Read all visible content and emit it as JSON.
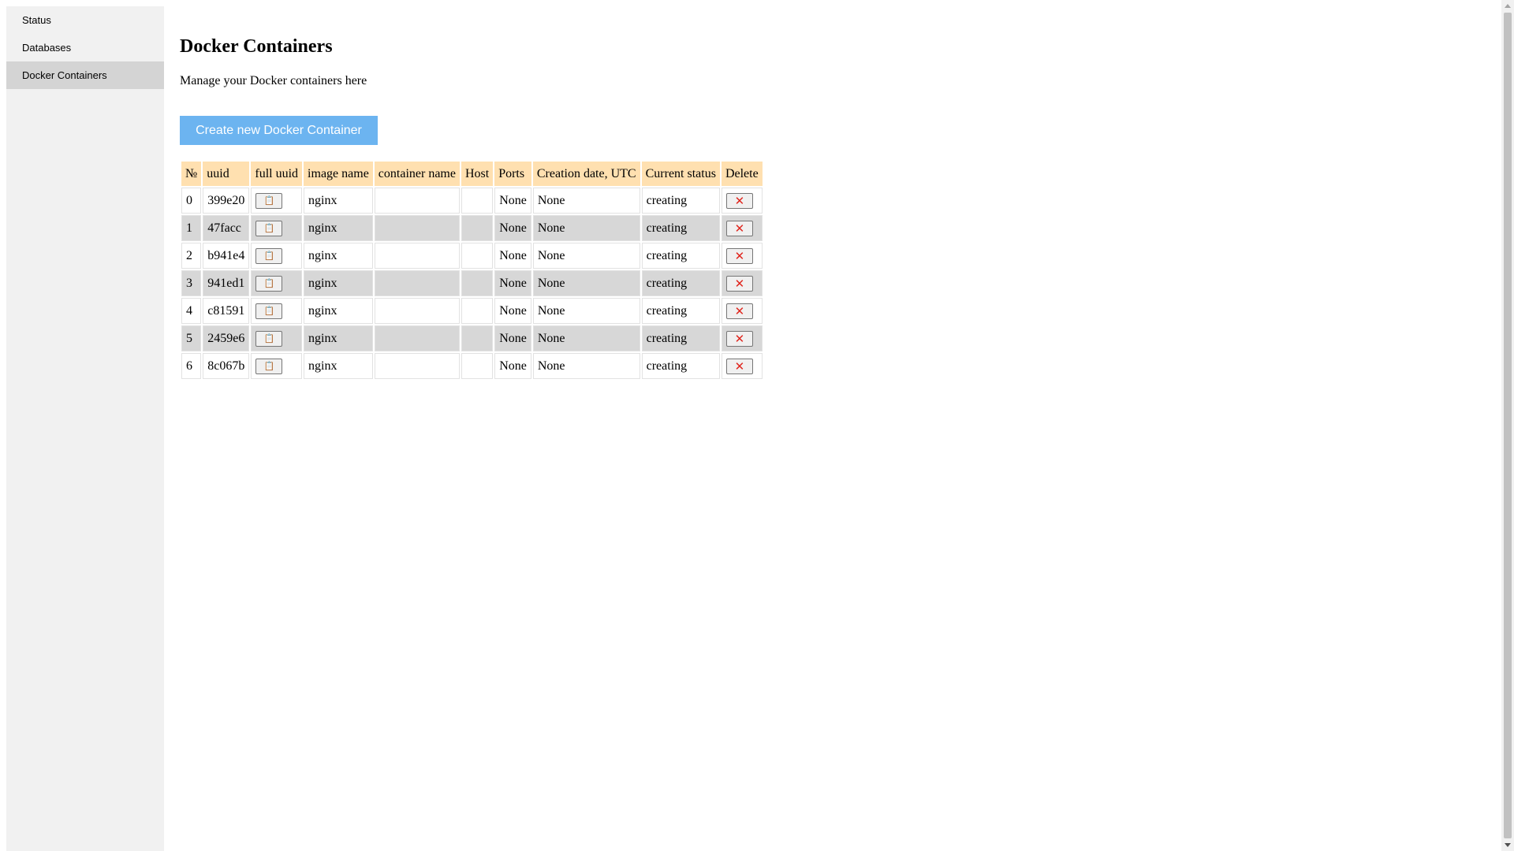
{
  "sidebar": {
    "items": [
      {
        "label": "Status"
      },
      {
        "label": "Databases"
      },
      {
        "label": "Docker Containers"
      }
    ],
    "active_index": 2
  },
  "main": {
    "title": "Docker Containers",
    "subtitle": "Manage your Docker containers here",
    "create_button_label": "Create new Docker Container"
  },
  "table": {
    "headers": [
      "№",
      "uuid",
      "full uuid",
      "image name",
      "container name",
      "Host",
      "Ports",
      "Creation date, UTC",
      "Current status",
      "Delete"
    ],
    "copy_icon": "📋",
    "delete_icon": "❌",
    "rows": [
      {
        "num": "0",
        "uuid": "399e20",
        "image": "nginx",
        "container": "",
        "host": "",
        "ports": "None",
        "created": "None",
        "status": "creating"
      },
      {
        "num": "1",
        "uuid": "47facc",
        "image": "nginx",
        "container": "",
        "host": "",
        "ports": "None",
        "created": "None",
        "status": "creating"
      },
      {
        "num": "2",
        "uuid": "b941e4",
        "image": "nginx",
        "container": "",
        "host": "",
        "ports": "None",
        "created": "None",
        "status": "creating"
      },
      {
        "num": "3",
        "uuid": "941ed1",
        "image": "nginx",
        "container": "",
        "host": "",
        "ports": "None",
        "created": "None",
        "status": "creating"
      },
      {
        "num": "4",
        "uuid": "c81591",
        "image": "nginx",
        "container": "",
        "host": "",
        "ports": "None",
        "created": "None",
        "status": "creating"
      },
      {
        "num": "5",
        "uuid": "2459e6",
        "image": "nginx",
        "container": "",
        "host": "",
        "ports": "None",
        "created": "None",
        "status": "creating"
      },
      {
        "num": "6",
        "uuid": "8c067b",
        "image": "nginx",
        "container": "",
        "host": "",
        "ports": "None",
        "created": "None",
        "status": "creating"
      }
    ]
  },
  "colors": {
    "accent": "#6cb4f0",
    "header_bg": "#ffe0b0",
    "stripe_bg": "#d7d7d7",
    "sidebar_bg": "#f1f1f1",
    "sidebar_active": "#d4d4d4"
  }
}
